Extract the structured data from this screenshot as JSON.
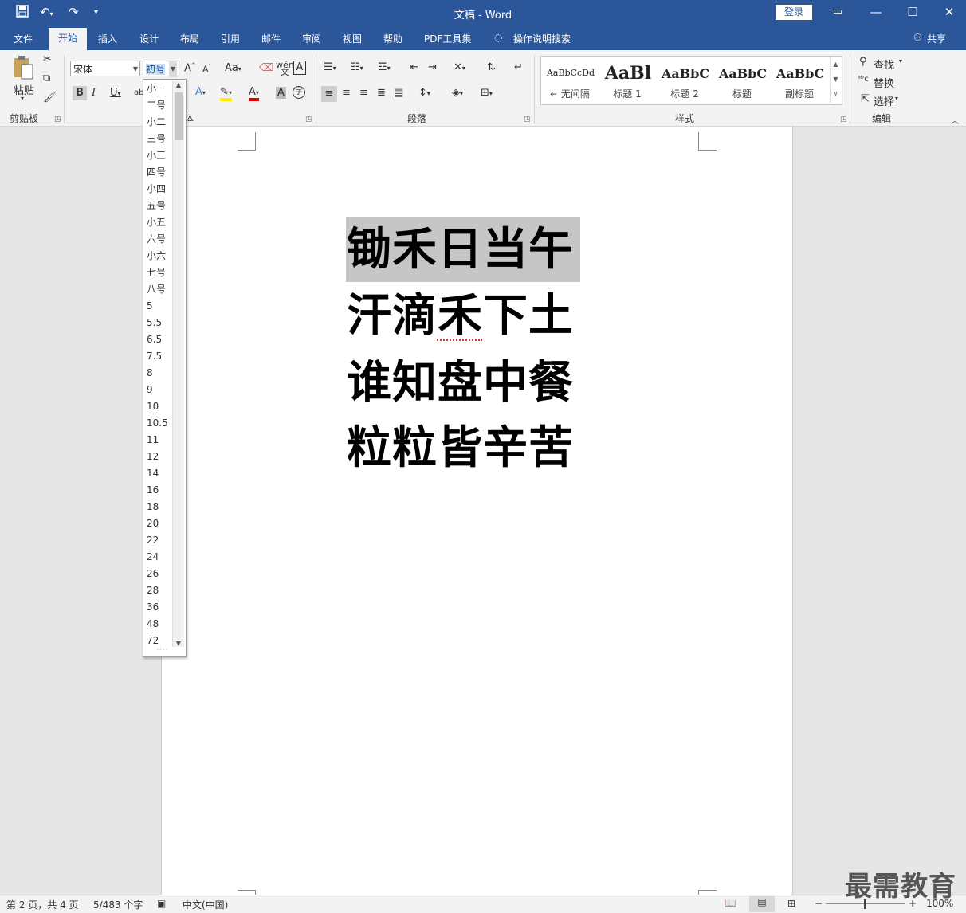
{
  "titlebar": {
    "title": "文稿  -  Word",
    "login": "登录",
    "qa_icons": [
      "save-icon",
      "undo-icon",
      "redo-icon",
      "customize-icon"
    ]
  },
  "tabs": [
    "文件",
    "开始",
    "插入",
    "设计",
    "布局",
    "引用",
    "邮件",
    "审阅",
    "视图",
    "帮助",
    "PDF工具集",
    "操作说明搜索"
  ],
  "share": "共享",
  "ribbon": {
    "clipboard": {
      "paste": "粘贴",
      "label": "剪贴板"
    },
    "font": {
      "font_name": "宋体",
      "font_size": "初号",
      "label": "体"
    },
    "paragraph": {
      "label": "段落"
    },
    "styles": {
      "label": "样式",
      "items": [
        {
          "preview": "AaBbCcDd",
          "name": "↵ 无间隔"
        },
        {
          "preview": "AaBl",
          "name": "标题 1"
        },
        {
          "preview": "AaBbC",
          "name": "标题 2"
        },
        {
          "preview": "AaBbC",
          "name": "标题"
        },
        {
          "preview": "AaBbC",
          "name": "副标题"
        }
      ]
    },
    "editing": {
      "find": "查找",
      "replace": "替换",
      "select": "选择",
      "label": "编辑"
    }
  },
  "size_dropdown": {
    "options": [
      "小一",
      "二号",
      "小二",
      "三号",
      "小三",
      "四号",
      "小四",
      "五号",
      "小五",
      "六号",
      "小六",
      "七号",
      "八号",
      "5",
      "5.5",
      "6.5",
      "7.5",
      "8",
      "9",
      "10",
      "10.5",
      "11",
      "12",
      "14",
      "16",
      "18",
      "20",
      "22",
      "24",
      "26",
      "28",
      "36",
      "48",
      "72"
    ]
  },
  "document": {
    "lines": [
      "锄禾日当午",
      "汗滴禾下土",
      "谁知盘中餐",
      "粒粒皆辛苦"
    ]
  },
  "statusbar": {
    "page": "第 2 页，共 4 页",
    "words": "5/483 个字",
    "language": "中文(中国)",
    "zoom": "100%"
  },
  "watermark": "最需教育"
}
